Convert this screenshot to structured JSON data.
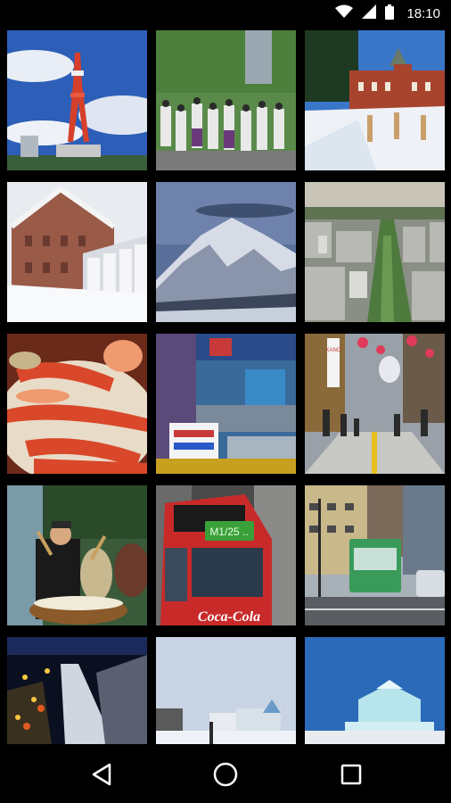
{
  "status_bar": {
    "time": "18:10",
    "icons": [
      "wifi-icon",
      "cellular-signal-icon",
      "battery-icon"
    ]
  },
  "gallery": {
    "tiles": [
      {
        "subject": "Sapporo TV Tower"
      },
      {
        "subject": "Festival dancers parade"
      },
      {
        "subject": "Red brick government building in snow"
      },
      {
        "subject": "Brick warehouse with snow sculptures"
      },
      {
        "subject": "Snow-covered mountain"
      },
      {
        "subject": "City aerial view with Odori Park"
      },
      {
        "subject": "King crab dish"
      },
      {
        "subject": "Market shop front"
      },
      {
        "subject": "Shopping arcade street"
      },
      {
        "subject": "Taiko drummer"
      },
      {
        "subject": "Red streetcar"
      },
      {
        "subject": "Green tram on city street"
      },
      {
        "subject": "Ski jump at night"
      },
      {
        "subject": "Snow festival site"
      },
      {
        "subject": "Ice sculpture"
      }
    ],
    "signs": {
      "tram_sign": "M1/25 ..",
      "tram_ad": "Coca-Cola",
      "arcade_sign": "KANO"
    }
  },
  "nav_bar": {
    "buttons": [
      "back-icon",
      "home-icon",
      "recents-icon"
    ]
  }
}
